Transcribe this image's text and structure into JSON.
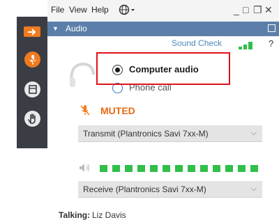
{
  "menu": {
    "file": "File",
    "view": "View",
    "help": "Help"
  },
  "window_controls": {
    "minimize": "_",
    "restore": "□",
    "maximize": "❐",
    "close": "✕"
  },
  "audio_panel": {
    "header_label": "Audio",
    "sound_check_label": "Sound Check",
    "help_label": "?",
    "options": [
      {
        "label": "Computer audio",
        "selected": true
      },
      {
        "label": "Phone call",
        "selected": false
      }
    ],
    "mute_status": "MUTED",
    "transmit_device": "Transmit (Plantronics Savi 7xx-M)",
    "receive_device": "Receive (Plantronics Savi 7xx-M)",
    "meter_level_segments": 13,
    "talking_label": "Talking:",
    "talking_name": "Liz Davis"
  },
  "colors": {
    "rail": "#3a3d44",
    "header": "#5b7fa8",
    "accent_orange": "#f07b1f",
    "meter_green": "#2fbf4a",
    "highlight_red": "#e0111b",
    "muted_text": "#e66a12"
  }
}
